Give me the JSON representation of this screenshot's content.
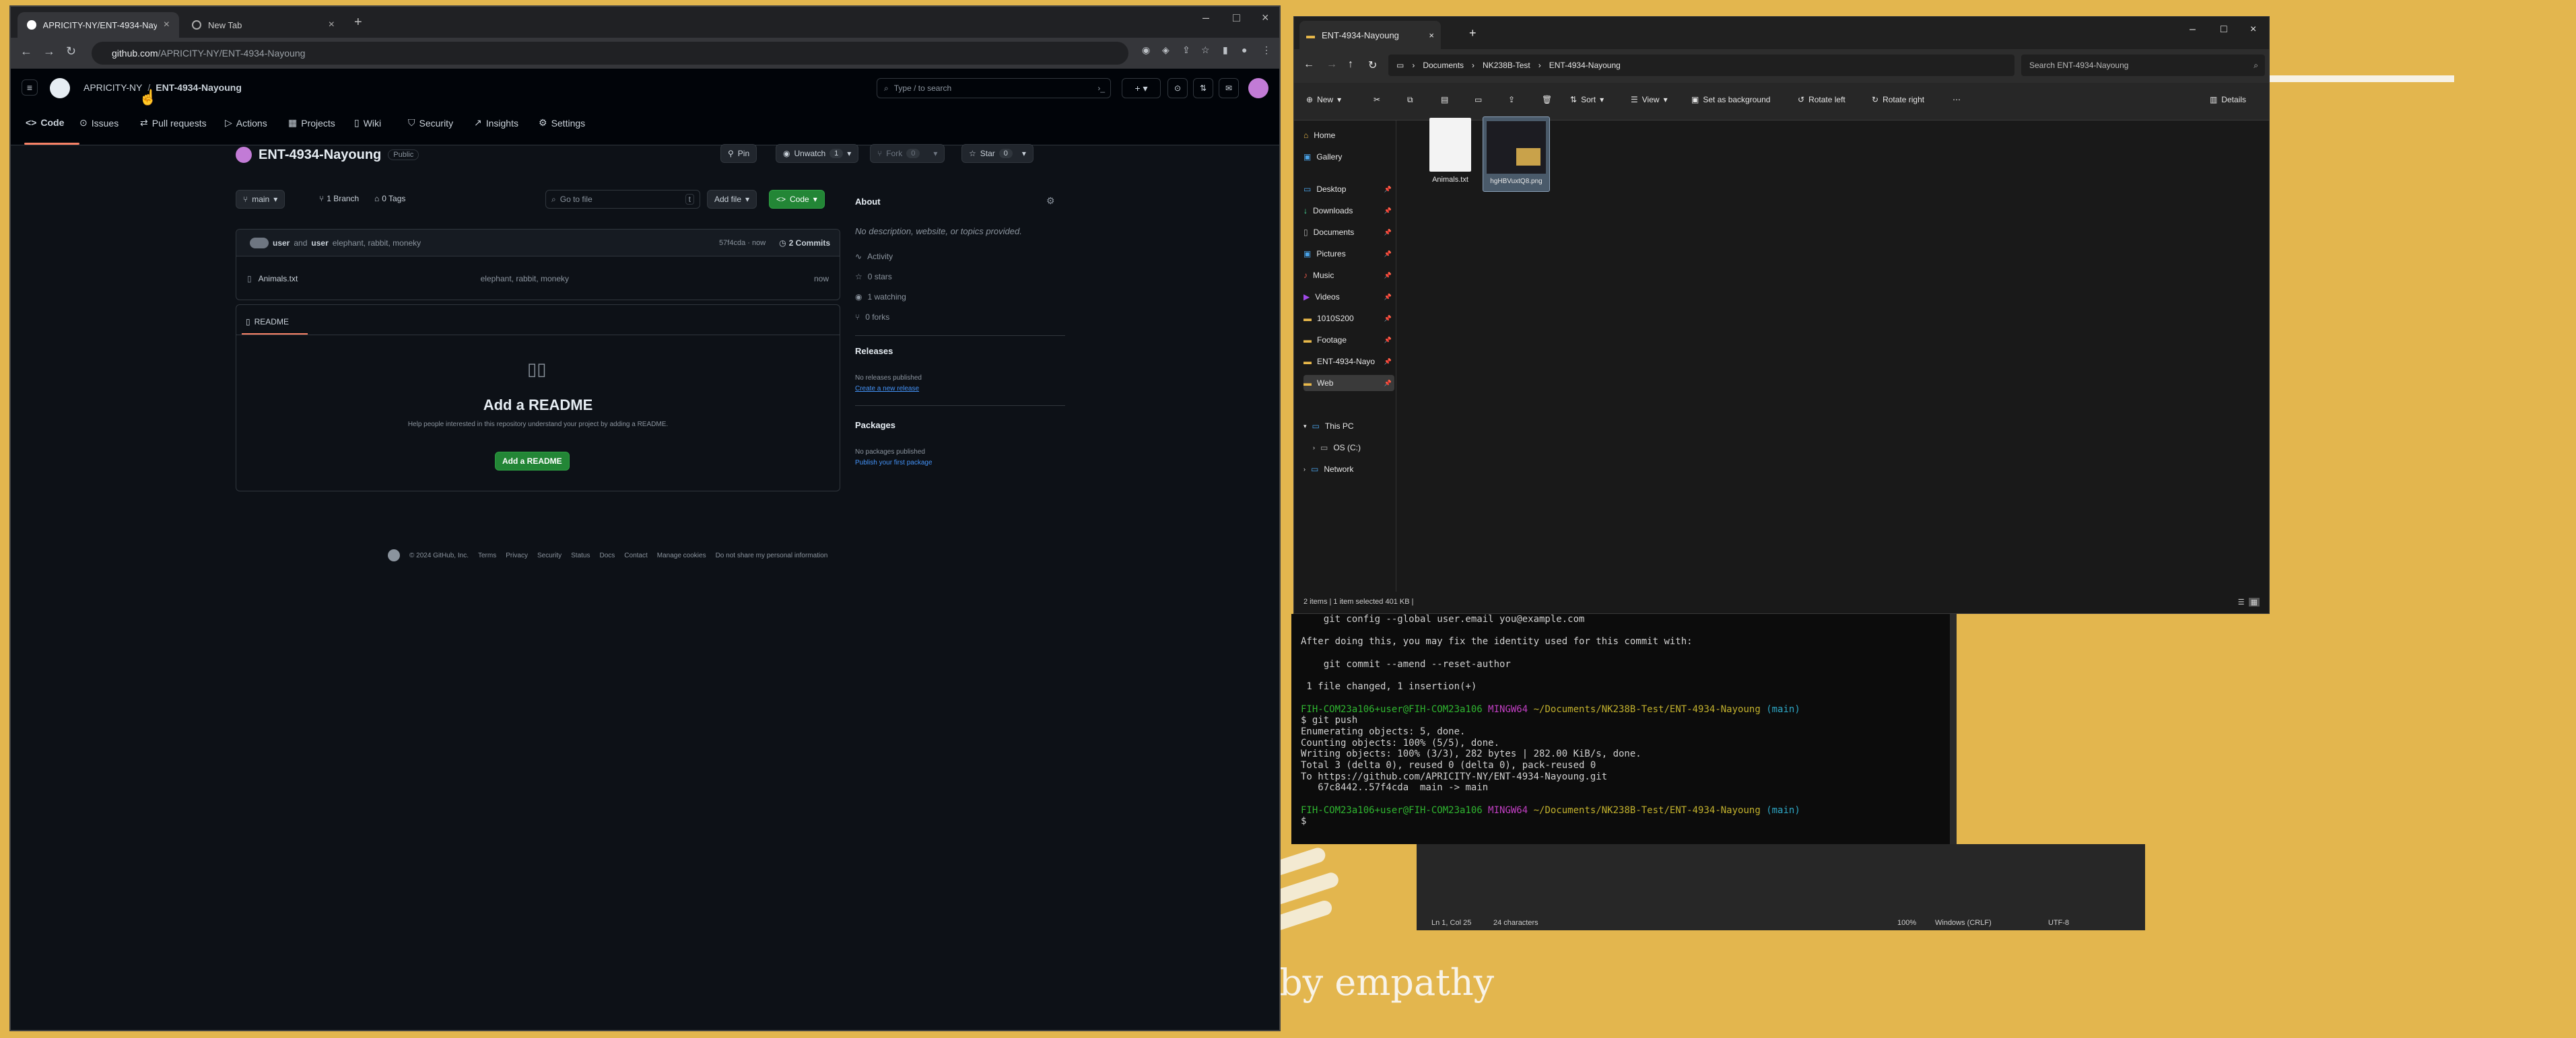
{
  "desktop": {
    "wallpaper_text": "by empathy"
  },
  "chrome": {
    "tabs": [
      {
        "title": "APRICITY-NY/ENT-4934-Nayoung"
      },
      {
        "title": "New Tab"
      }
    ],
    "url_host": "github.com",
    "url_path": "/APRICITY-NY/ENT-4934-Nayoung"
  },
  "github": {
    "breadcrumb_owner": "APRICITY-NY",
    "breadcrumb_sep": "/",
    "breadcrumb_repo": "ENT-4934-Nayoung",
    "search_placeholder": "Type / to search",
    "nav": [
      {
        "label": "Code",
        "icon": "code-icon"
      },
      {
        "label": "Issues",
        "icon": "issue-icon"
      },
      {
        "label": "Pull requests",
        "icon": "pull-request-icon"
      },
      {
        "label": "Actions",
        "icon": "play-icon"
      },
      {
        "label": "Projects",
        "icon": "table-icon"
      },
      {
        "label": "Wiki",
        "icon": "book-icon"
      },
      {
        "label": "Security",
        "icon": "shield-icon"
      },
      {
        "label": "Insights",
        "icon": "graph-icon"
      },
      {
        "label": "Settings",
        "icon": "gear-icon"
      }
    ],
    "repo_name": "ENT-4934-Nayoung",
    "visibility": "Public",
    "pin": "Pin",
    "unwatch": "Unwatch",
    "unwatch_count": "1",
    "fork": "Fork",
    "fork_count": "0",
    "star": "Star",
    "star_count": "0",
    "branch": "main",
    "branches": "1 Branch",
    "tags": "0 Tags",
    "goto_file": "Go to file",
    "goto_key": "t",
    "add_file": "Add file",
    "code_btn": "Code",
    "commit_user1": "user",
    "commit_and": "and",
    "commit_user2": "user",
    "commit_msg": "elephant, rabbit, moneky",
    "commit_hash": "57f4cda · now",
    "commits": "2 Commits",
    "files": [
      {
        "name": "Animals.txt",
        "msg": "elephant, rabbit, moneky",
        "time": "now"
      }
    ],
    "readme_tab": "README",
    "readme_heading": "Add a README",
    "readme_desc": "Help people interested in this repository understand your project by adding a README.",
    "readme_btn": "Add a README",
    "about": {
      "title": "About",
      "desc": "No description, website, or topics provided.",
      "activity": "Activity",
      "stars": "0 stars",
      "watching": "1 watching",
      "forks": "0 forks"
    },
    "releases": {
      "title": "Releases",
      "none": "No releases published",
      "link": "Create a new release"
    },
    "packages": {
      "title": "Packages",
      "none": "No packages published",
      "link": "Publish your first package"
    },
    "footer": [
      "© 2024 GitHub, Inc.",
      "Terms",
      "Privacy",
      "Security",
      "Status",
      "Docs",
      "Contact",
      "Manage cookies",
      "Do not share my personal information"
    ]
  },
  "explorer": {
    "tab_title": "ENT-4934-Nayoung",
    "breadcrumb": [
      "Documents",
      "NK238B-Test",
      "ENT-4934-Nayoung"
    ],
    "search_placeholder": "Search ENT-4934-Nayoung",
    "commands": {
      "new": "New",
      "sort": "Sort",
      "view": "View",
      "set_bg": "Set as background",
      "rotate_left": "Rotate left",
      "rotate_right": "Rotate right",
      "details": "Details"
    },
    "sidebar": [
      "Home",
      "Gallery",
      "Desktop",
      "Downloads",
      "Documents",
      "Pictures",
      "Music",
      "Videos",
      "1010S200",
      "Footage",
      "ENT-4934-Nayo",
      "Web",
      "This PC",
      "OS (C:)",
      "Network"
    ],
    "files": [
      {
        "name": "Animals.txt"
      },
      {
        "name": "hgHBVuxtQ8.png"
      }
    ],
    "status": "2 items  |  1 item selected  401 KB  |"
  },
  "terminal": {
    "lines": [
      {
        "t": "    git config --global user.email you@example.com",
        "cls": ""
      },
      {
        "t": "",
        "cls": ""
      },
      {
        "t": "After doing this, you may fix the identity used for this commit with:",
        "cls": ""
      },
      {
        "t": "",
        "cls": ""
      },
      {
        "t": "    git commit --amend --reset-author",
        "cls": ""
      },
      {
        "t": "",
        "cls": ""
      },
      {
        "t": " 1 file changed, 1 insertion(+)",
        "cls": ""
      },
      {
        "t": "",
        "cls": ""
      },
      {
        "prompt": true,
        "user": "FIH-COM23a106+user@FIH-COM23a106",
        "sys": "MINGW64",
        "path": "~/Documents/NK238B-Test/ENT-4934-Nayoung",
        "branch": "(main)"
      },
      {
        "t": "$ git push",
        "cls": ""
      },
      {
        "t": "Enumerating objects: 5, done.",
        "cls": ""
      },
      {
        "t": "Counting objects: 100% (5/5), done.",
        "cls": ""
      },
      {
        "t": "Writing objects: 100% (3/3), 282 bytes | 282.00 KiB/s, done.",
        "cls": ""
      },
      {
        "t": "Total 3 (delta 0), reused 0 (delta 0), pack-reused 0",
        "cls": ""
      },
      {
        "t": "To https://github.com/APRICITY-NY/ENT-4934-Nayoung.git",
        "cls": ""
      },
      {
        "t": "   67c8442..57f4cda  main -> main",
        "cls": ""
      },
      {
        "t": "",
        "cls": ""
      },
      {
        "prompt": true,
        "user": "FIH-COM23a106+user@FIH-COM23a106",
        "sys": "MINGW64",
        "path": "~/Documents/NK238B-Test/ENT-4934-Nayoung",
        "branch": "(main)"
      },
      {
        "t": "$ ",
        "cls": ""
      }
    ]
  },
  "notepad": {
    "position": "Ln 1, Col 25",
    "chars": "24 characters",
    "zoom": "100%",
    "eol": "Windows (CRLF)",
    "enc": "UTF-8"
  }
}
